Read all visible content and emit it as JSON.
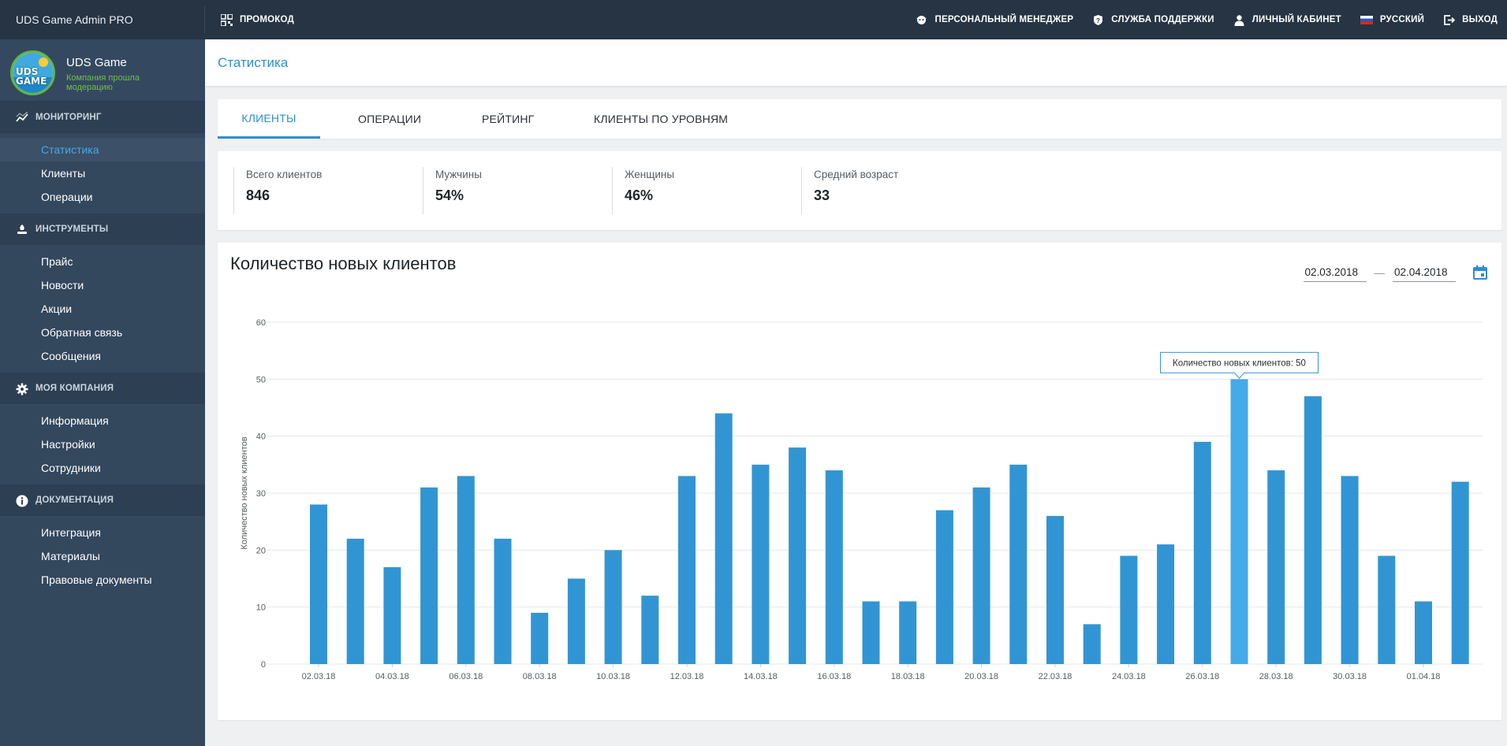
{
  "topbar": {
    "brand": "UDS Game Admin PRO",
    "promo": "ПРОМОКОД",
    "manager": "ПЕРСОНАЛЬНЫЙ МЕНЕДЖЕР",
    "support": "СЛУЖБА ПОДДЕРЖКИ",
    "cabinet": "ЛИЧНЫЙ КАБИНЕТ",
    "language": "РУССКИЙ",
    "exit": "ВЫХОД"
  },
  "company": {
    "name": "UDS Game",
    "status": "Компания прошла модерацию",
    "logo_text": "UDS GAME"
  },
  "sidebar": {
    "sections": [
      {
        "title": "МОНИТОРИНГ",
        "icon": "chart-line-icon",
        "items": [
          "Статистика",
          "Клиенты",
          "Операции"
        ]
      },
      {
        "title": "ИНСТРУМЕНТЫ",
        "icon": "tools-icon",
        "items": [
          "Прайс",
          "Новости",
          "Акции",
          "Обратная связь",
          "Сообщения"
        ]
      },
      {
        "title": "МОЯ КОМПАНИЯ",
        "icon": "gear-icon",
        "items": [
          "Информация",
          "Настройки",
          "Сотрудники"
        ]
      },
      {
        "title": "ДОКУМЕНТАЦИЯ",
        "icon": "info-icon",
        "items": [
          "Интеграция",
          "Материалы",
          "Правовые документы"
        ]
      }
    ],
    "active_item": "Статистика"
  },
  "page": {
    "title": "Статистика"
  },
  "tabs": [
    "КЛИЕНТЫ",
    "ОПЕРАЦИИ",
    "РЕЙТИНГ",
    "КЛИЕНТЫ ПО УРОВНЯМ"
  ],
  "active_tab": "КЛИЕНТЫ",
  "stats": [
    {
      "label": "Всего клиентов",
      "value": "846"
    },
    {
      "label": "Мужчины",
      "value": "54%"
    },
    {
      "label": "Женщины",
      "value": "46%"
    },
    {
      "label": "Средний возраст",
      "value": "33"
    }
  ],
  "chart_section": {
    "title": "Количество новых клиентов",
    "date_from": "02.03.2018",
    "date_to": "02.04.2018",
    "date_separator": "—"
  },
  "chart_data": {
    "type": "bar",
    "title": "",
    "ylabel": "Количество новых клиентов",
    "xlabel": "",
    "ylim": [
      0,
      60
    ],
    "yticks": [
      0,
      10,
      20,
      30,
      40,
      50,
      60
    ],
    "grid": true,
    "categories": [
      "02.03.18",
      "03.03.18",
      "04.03.18",
      "05.03.18",
      "06.03.18",
      "07.03.18",
      "08.03.18",
      "09.03.18",
      "10.03.18",
      "11.03.18",
      "12.03.18",
      "13.03.18",
      "14.03.18",
      "15.03.18",
      "16.03.18",
      "17.03.18",
      "18.03.18",
      "19.03.18",
      "20.03.18",
      "21.03.18",
      "22.03.18",
      "23.03.18",
      "24.03.18",
      "25.03.18",
      "26.03.18",
      "27.03.18",
      "28.03.18",
      "29.03.18",
      "30.03.18",
      "31.03.18",
      "01.04.18",
      "02.04.18"
    ],
    "x_tick_labels": [
      "02.03.18",
      "04.03.18",
      "06.03.18",
      "08.03.18",
      "10.03.18",
      "12.03.18",
      "14.03.18",
      "16.03.18",
      "18.03.18",
      "20.03.18",
      "22.03.18",
      "24.03.18",
      "26.03.18",
      "28.03.18",
      "30.03.18",
      "01.04.18"
    ],
    "values": [
      28,
      22,
      17,
      31,
      33,
      22,
      9,
      15,
      20,
      12,
      33,
      44,
      35,
      38,
      34,
      11,
      11,
      27,
      31,
      35,
      26,
      7,
      19,
      21,
      39,
      50,
      34,
      47,
      33,
      19,
      11,
      32
    ],
    "highlight_index": 25,
    "tooltip": "Количество новых клиентов: 50",
    "colors": {
      "bar": "#3295d3",
      "bar_highlight": "#45aaea",
      "grid": "#e4e7ea",
      "axis_text": "#555c63"
    }
  },
  "colors": {
    "topbar": "#263444",
    "sidebar": "#33475d",
    "accent": "#2d8fd0",
    "status_green": "#6ec046"
  }
}
